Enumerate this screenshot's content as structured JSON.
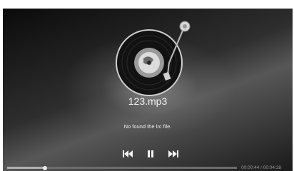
{
  "track": {
    "title": "123.mp3"
  },
  "lyrics": {
    "message": "No found the lrc file."
  },
  "controls": {
    "prev_icon": "skip-previous-icon",
    "pause_icon": "pause-icon",
    "next_icon": "skip-next-icon"
  },
  "progress": {
    "current_time": "00:00:44",
    "separator": "/",
    "total_time": "00:04:28",
    "fraction": 0.164
  },
  "colors": {
    "background_dark": "#1a1a1a",
    "text": "#f2f2f2",
    "time_text": "#9a9a9a"
  }
}
